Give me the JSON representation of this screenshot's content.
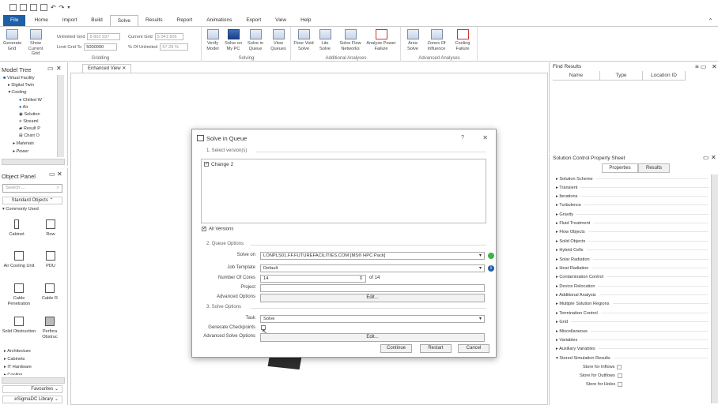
{
  "tabs": [
    "File",
    "Home",
    "Import",
    "Build",
    "Solve",
    "Results",
    "Report",
    "Animations",
    "Export",
    "View",
    "Help"
  ],
  "active_tab": "Solve",
  "ribbon": {
    "gridding": {
      "label": "Gridding",
      "generate_grid": "Generate Grid",
      "show_current_grid": "Show Current Grid",
      "limit_grid_to": "Limit Grid To",
      "unlimited_grid_label": "Unlimited Grid",
      "unlimited_grid_value": "8 802 937",
      "current_grid_label": "Current Grid",
      "current_grid_value": "5 041 826",
      "limit_value": "5000000",
      "pct_label": "% Of Unlimited",
      "pct_value": "57.28 %"
    },
    "solving": {
      "label": "Solving",
      "verify_model": "Verify Model",
      "solve_on_pc": "Solve on My PC",
      "solve_in_queue": "Solve in Queue",
      "view_queues": "View Queues"
    },
    "additional": {
      "label": "Additional Analyses",
      "floor_void_solve": "Floor Void Solve",
      "lite_solve": "Lite Solve",
      "solve_flow_networks": "Solve Flow Networks",
      "analyse_power_failure": "Analyse Power Failure"
    },
    "advanced": {
      "label": "Advanced Analyses",
      "area_solve": "Area Solve",
      "zones_of_influence": "Zones Of Influence",
      "cooling_failure": "Cooling Failure"
    }
  },
  "model_tree": {
    "title": "Model Tree",
    "items": [
      "Virtual Facility",
      "Digital Twin",
      "Cooling",
      "Chilled W",
      "Air",
      "Solution",
      "Streaml",
      "Result P",
      "Chart O",
      "Materials",
      "Power"
    ]
  },
  "object_panel": {
    "title": "Object Panel",
    "search_placeholder": "Search....",
    "standard_objects": "Standard Objects",
    "commonly_used": "Commonly Used",
    "objects": [
      "Cabinet",
      "Row",
      "Air Cooling Unit",
      "PDU",
      "Cable Penetration",
      "Cable R",
      "Solid Obstruction",
      "Perfora Obstruc"
    ],
    "categories": [
      "Architecture",
      "Cabinets",
      "IT Hardware",
      "Cooling"
    ],
    "favourites": "Favourites",
    "library": "eSigmaDC Library"
  },
  "document_tab": "Enhanced View",
  "dialog": {
    "title": "Solve in Queue",
    "help": "?",
    "close": "✕",
    "section1": "1. Select version(s)",
    "versions": [
      "Change 2"
    ],
    "all_versions": "All Versions",
    "section2": "2. Queue Options",
    "solve_on_label": "Solve on",
    "solve_on_value": "LONPLS01.FF.FUTUREFACILITIES.COM [MS® HPC Pack]",
    "job_template_label": "Job Template",
    "job_template_value": "Default",
    "cores_label": "Number Of Cores",
    "cores_value": "14",
    "cores_of": "of  14",
    "project_label": "Project",
    "project_value": "",
    "advanced_options_label": "Advanced Options",
    "edit_label": "Edit...",
    "section3": "3. Solve Options",
    "task_label": "Task",
    "task_value": "Solve",
    "checkpoints_label": "Generate Checkpoints",
    "advanced_solve_label": "Advanced Solve Options",
    "continue": "Continue",
    "restart": "Restart",
    "cancel": "Cancel"
  },
  "find_results": {
    "title": "Find Results",
    "columns": [
      "Name",
      "Type",
      "Location ID"
    ]
  },
  "solution_sheet": {
    "title": "Solution Control Property Sheet",
    "tab_properties": "Properties",
    "tab_results": "Results",
    "items": [
      "Solution Scheme",
      "Transient",
      "Iterations",
      "Turbulence",
      "Gravity",
      "Fluid Treatment",
      "Flow Objects",
      "Solid Objects",
      "Hybrid Cells",
      "Solar Radiation",
      "Heat Radiation",
      "Contamination Control",
      "Device Relocation",
      "Additional Analysis",
      "Multiple Solution Regions",
      "Termination Control",
      "Grid",
      "Miscellaneous",
      "Variables",
      "Auxiliary Variables",
      "Stored Simulation Results"
    ],
    "store_inflows": "Store for Inflows",
    "store_outflows": "Store for Outflows",
    "store_holes": "Store for Holes"
  },
  "colors": {
    "accent": "#1e5fa8",
    "ok": "#3db34a"
  }
}
